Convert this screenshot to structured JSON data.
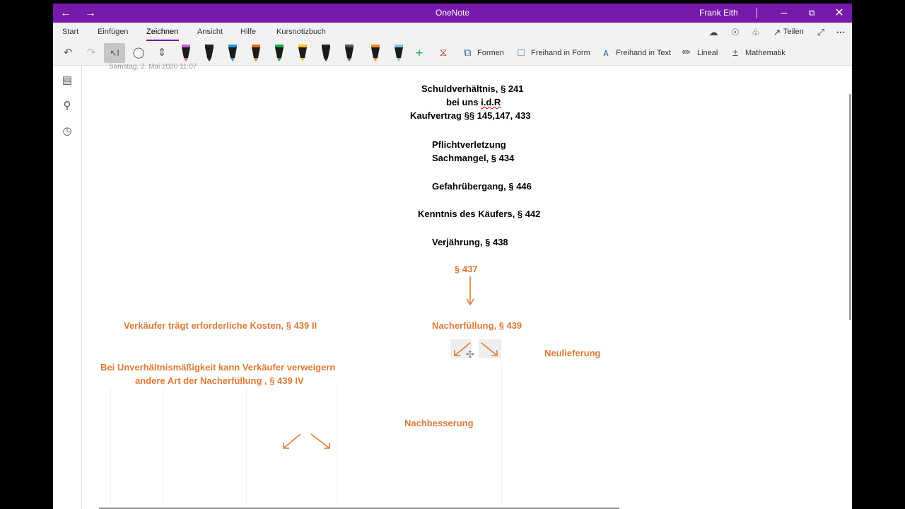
{
  "window": {
    "title": "OneNote",
    "user": "Frank Eith"
  },
  "menu": {
    "tabs": [
      "Start",
      "Einfügen",
      "Zeichnen",
      "Ansicht",
      "Hilfe",
      "Kursnotizbuch"
    ],
    "active_tab": "Zeichnen",
    "share_label": "Teilen"
  },
  "ribbon": {
    "formen": "Formen",
    "freihand_in_form": "Freihand in Form",
    "freihand_in_text": "Freihand in Text",
    "lineal": "Lineal",
    "mathematik": "Mathematik",
    "pen_colors": [
      "#d25bd8",
      "#222222",
      "#1e9bd7",
      "#e86a2b",
      "#1aa84e",
      "#f2c21a",
      "#222222",
      "#555555",
      "#f08a24",
      "#7fc3e8"
    ]
  },
  "page": {
    "date_partial": "Samstag, 2. Mai 2020        11:07",
    "lines": {
      "schuld1": "Schuldverhältnis, § 241",
      "schuld2_prefix": "bei uns ",
      "schuld2_abbr": "i.d.R",
      "schuld3": "Kaufvertrag §§ 145,147, 433",
      "pflicht1": "Pflichtverletzung",
      "pflicht2": "Sachmangel, § 434",
      "gefahr": "Gefahrübergang, § 446",
      "kenntnis": "Kenntnis des Käufers, § 442",
      "verjaehrung": "Verjährung, § 438",
      "p437": "§ 437",
      "kosten": "Verkäufer trägt erforderliche Kosten, § 439 II",
      "nacherfuellung": "Nacherfüllung, § 439",
      "neulieferung": "Neulieferung",
      "unverh1": "Bei Unverhältnismäßigkeit kann Verkäufer verweigern",
      "unverh2": "andere Art der Nacherfüllung , § 439 IV",
      "nachbesserung": "Nachbesserung"
    }
  },
  "colors": {
    "titlebar": "#7719aa",
    "accent_text": "#e07a36",
    "ink": "#000000"
  }
}
